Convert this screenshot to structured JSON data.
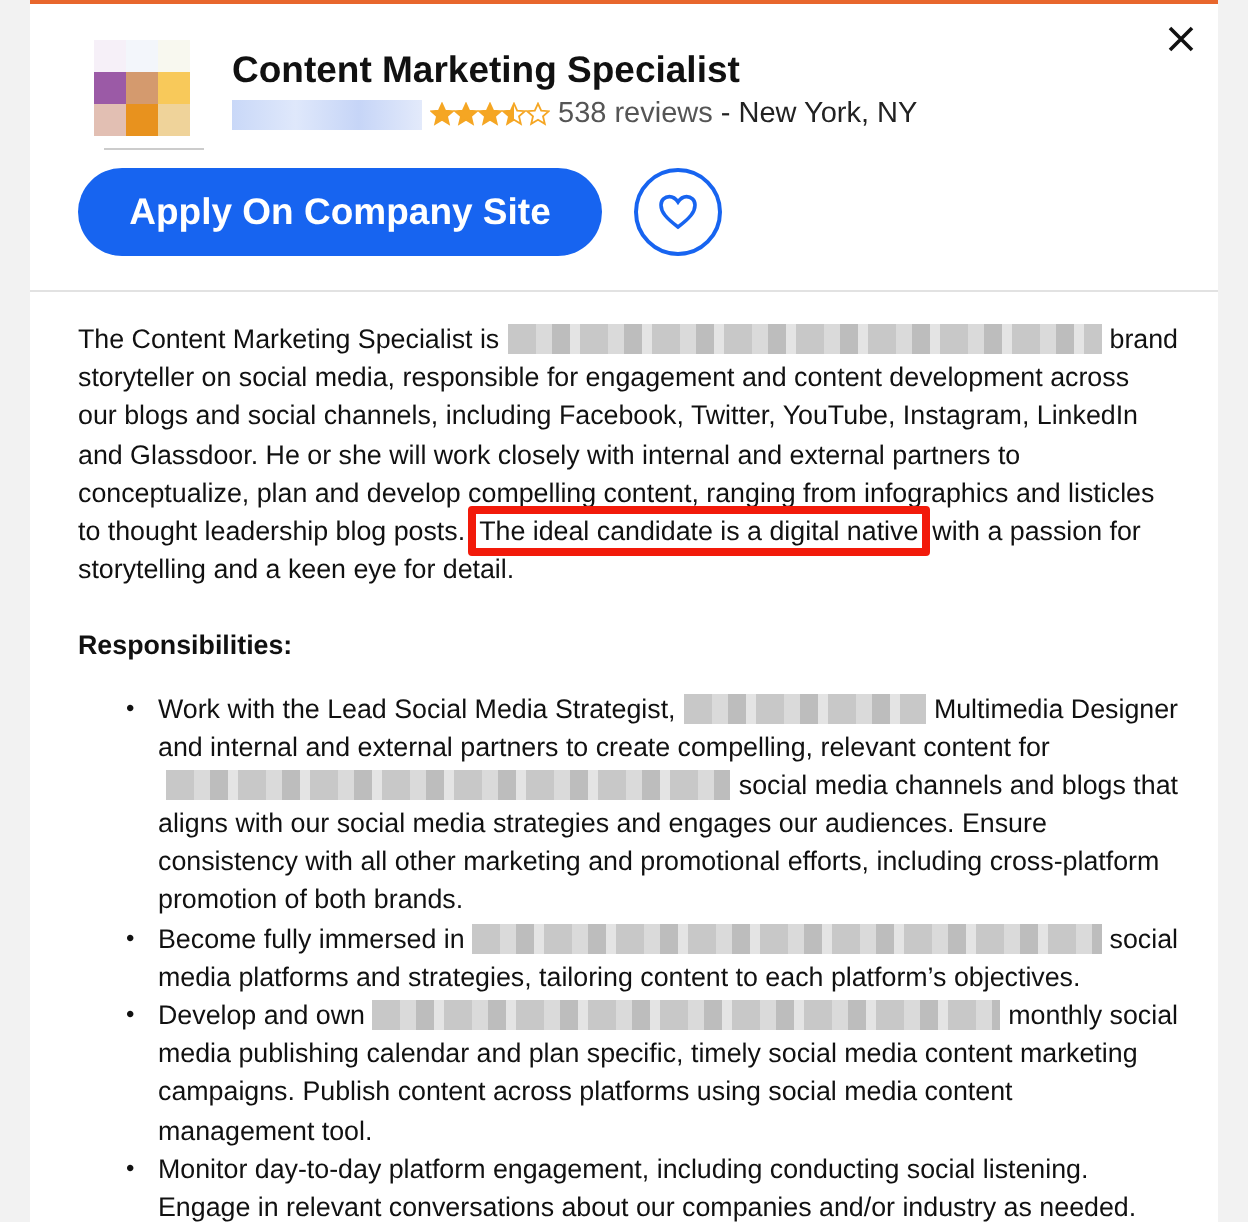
{
  "header": {
    "title": "Content Marketing Specialist",
    "company": {
      "kind": "redacted"
    },
    "stars": 3.5,
    "reviews": "538 reviews",
    "location": "- New York, NY"
  },
  "actions": {
    "apply": "Apply On Company Site",
    "saved": false
  },
  "description": [
    [
      {
        "kind": "text",
        "text": "The Content Marketing Specialist is"
      },
      {
        "kind": "redacted"
      },
      {
        "kind": "text",
        "text": "brand"
      }
    ],
    [
      {
        "kind": "text",
        "text": "storyteller on social media, responsible for engagement and content development across"
      }
    ],
    [
      {
        "kind": "text",
        "text": "our blogs and social channels, including Facebook, Twitter, YouTube, Instagram, LinkedIn"
      }
    ],
    [
      {
        "kind": "text",
        "text": "and Glassdoor. He or she will work closely with internal and external partners to"
      }
    ],
    [
      {
        "kind": "text",
        "text": "conceptualize, plan and develop compelling content, ranging from infographics and listicles"
      }
    ],
    [
      {
        "kind": "text",
        "text": "to thought leadership blog posts."
      },
      {
        "kind": "highlight",
        "text": "The ideal candidate is a digital native"
      },
      {
        "kind": "text",
        "text": "with a passion for"
      }
    ],
    [
      {
        "kind": "text",
        "text": "storytelling and a keen eye for detail."
      }
    ]
  ],
  "responsibilities": {
    "heading": "Responsibilities:",
    "items": [
      {
        "marker": "•",
        "lines": [
          [
            {
              "kind": "text",
              "text": "Work with the Lead Social Media Strategist,"
            },
            {
              "kind": "redacted"
            },
            {
              "kind": "text",
              "text": "Multimedia Designer"
            }
          ],
          [
            {
              "kind": "text",
              "text": "and internal and external partners to create compelling, relevant content for"
            }
          ],
          [
            {
              "kind": "redacted"
            },
            {
              "kind": "text",
              "text": "social media channels and blogs that"
            }
          ],
          [
            {
              "kind": "text",
              "text": "aligns with our social media strategies and engages our audiences. Ensure"
            }
          ],
          [
            {
              "kind": "text",
              "text": "consistency with all other marketing and promotional efforts, including cross-platform"
            }
          ],
          [
            {
              "kind": "text",
              "text": "promotion of both brands."
            }
          ]
        ]
      },
      {
        "marker": "•",
        "lines": [
          [
            {
              "kind": "text",
              "text": "Become fully immersed in"
            },
            {
              "kind": "redacted"
            },
            {
              "kind": "text",
              "text": "social"
            }
          ],
          [
            {
              "kind": "text",
              "text": "media platforms and strategies, tailoring content to each platform’s objectives."
            }
          ]
        ]
      },
      {
        "marker": "•",
        "lines": [
          [
            {
              "kind": "text",
              "text": "Develop and own"
            },
            {
              "kind": "redacted"
            },
            {
              "kind": "text",
              "text": "monthly social"
            }
          ],
          [
            {
              "kind": "text",
              "text": "media publishing calendar and plan specific, timely social media content marketing"
            }
          ],
          [
            {
              "kind": "text",
              "text": "campaigns. Publish content across platforms using social media content"
            }
          ],
          [
            {
              "kind": "text",
              "text": "management tool."
            }
          ]
        ]
      },
      {
        "marker": "•",
        "lines": [
          [
            {
              "kind": "text",
              "text": "Monitor day-to-day platform engagement, including conducting social listening."
            }
          ],
          [
            {
              "kind": "text",
              "text": "Engage in relevant conversations about our companies and/or industry as needed."
            }
          ]
        ]
      }
    ]
  }
}
